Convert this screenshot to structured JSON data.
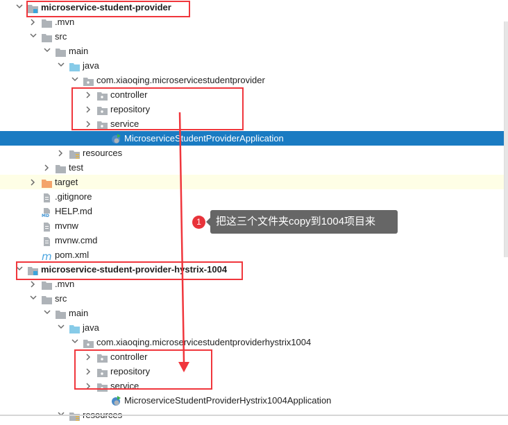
{
  "tree": [
    {
      "label": "microservice-student-provider",
      "level": 0,
      "chevron": "open",
      "icon": "module-folder",
      "bold": true
    },
    {
      "label": ".mvn",
      "level": 1,
      "chevron": "closed",
      "icon": "folder"
    },
    {
      "label": "src",
      "level": 1,
      "chevron": "open",
      "icon": "folder"
    },
    {
      "label": "main",
      "level": 2,
      "chevron": "open",
      "icon": "folder"
    },
    {
      "label": "java",
      "level": 3,
      "chevron": "open",
      "icon": "source-folder"
    },
    {
      "label": "com.xiaoqing.microservicestudentprovider",
      "level": 4,
      "chevron": "open",
      "icon": "package"
    },
    {
      "label": "controller",
      "level": 5,
      "chevron": "closed",
      "icon": "package"
    },
    {
      "label": "repository",
      "level": 5,
      "chevron": "closed",
      "icon": "package"
    },
    {
      "label": "service",
      "level": 5,
      "chevron": "closed",
      "icon": "package"
    },
    {
      "label": "MicroserviceStudentProviderApplication",
      "level": 6,
      "chevron": "none",
      "icon": "spring-boot-class",
      "selected": true
    },
    {
      "label": "resources",
      "level": 3,
      "chevron": "closed",
      "icon": "resources-folder"
    },
    {
      "label": "test",
      "level": 2,
      "chevron": "closed",
      "icon": "folder"
    },
    {
      "label": "target",
      "level": 1,
      "chevron": "closed",
      "icon": "excluded-folder",
      "highlighted": true
    },
    {
      "label": ".gitignore",
      "level": 1,
      "chevron": "none",
      "icon": "file"
    },
    {
      "label": "HELP.md",
      "level": 1,
      "chevron": "none",
      "icon": "markdown-file"
    },
    {
      "label": "mvnw",
      "level": 1,
      "chevron": "none",
      "icon": "file"
    },
    {
      "label": "mvnw.cmd",
      "level": 1,
      "chevron": "none",
      "icon": "file"
    },
    {
      "label": "pom.xml",
      "level": 1,
      "chevron": "none",
      "icon": "maven-file"
    },
    {
      "label": "microservice-student-provider-hystrix-1004",
      "level": 0,
      "chevron": "open",
      "icon": "module-folder",
      "bold": true
    },
    {
      "label": ".mvn",
      "level": 1,
      "chevron": "closed",
      "icon": "folder"
    },
    {
      "label": "src",
      "level": 1,
      "chevron": "open",
      "icon": "folder"
    },
    {
      "label": "main",
      "level": 2,
      "chevron": "open",
      "icon": "folder"
    },
    {
      "label": "java",
      "level": 3,
      "chevron": "open",
      "icon": "source-folder"
    },
    {
      "label": "com.xiaoqing.microservicestudentproviderhystrix1004",
      "level": 4,
      "chevron": "open",
      "icon": "package"
    },
    {
      "label": "controller",
      "level": 5,
      "chevron": "closed",
      "icon": "package"
    },
    {
      "label": "repository",
      "level": 5,
      "chevron": "closed",
      "icon": "package"
    },
    {
      "label": "service",
      "level": 5,
      "chevron": "closed",
      "icon": "package"
    },
    {
      "label": "MicroserviceStudentProviderHystrix1004Application",
      "level": 6,
      "chevron": "none",
      "icon": "spring-boot-class"
    },
    {
      "label": "resources",
      "level": 3,
      "chevron": "open",
      "icon": "resources-folder"
    }
  ],
  "annotation": {
    "badge": "1",
    "text": "把这三个文件夹copy到1004项目来"
  },
  "colors": {
    "selection": "#1a7bc2",
    "annotation_red": "#f0363c",
    "tooltip_bg": "#666666",
    "highlight_row": "#fefee6"
  }
}
